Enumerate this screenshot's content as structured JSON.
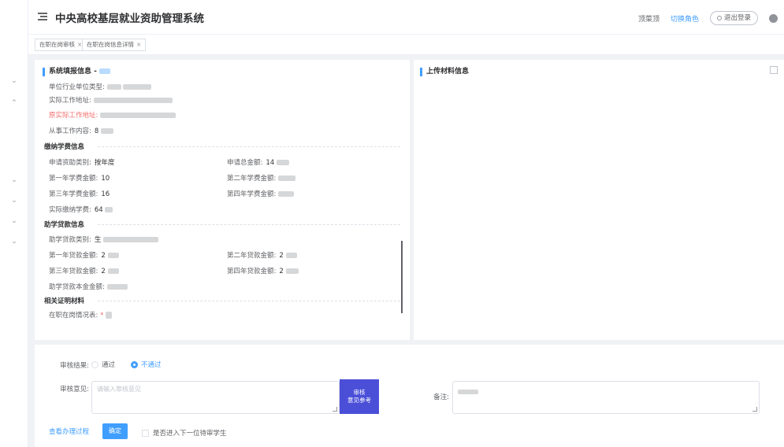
{
  "header": {
    "title": "中央高校基层就业资助管理系统",
    "links": [
      "顶菜顶",
      "切换角色"
    ],
    "logout": "退出登录"
  },
  "tabs": [
    {
      "label": "在职在岗审核"
    },
    {
      "label": "在职在岗信息详情"
    }
  ],
  "left_panel": {
    "title": "系统填报信息 - ",
    "rows": {
      "unit_type": "单位行业单位类型:",
      "work_address": "实际工作地址:",
      "original_address": "原实际工作地址:",
      "work_content": "从事工作内容:",
      "work_content_value": "8"
    },
    "tuition": {
      "title": "缴纳学费信息",
      "apply_type": "申请资助类别:",
      "apply_type_value": "按年度",
      "apply_total": "申请总金额:",
      "apply_total_value": "14",
      "y1": "第一年学费金额:",
      "y1_value": "10",
      "y2": "第二年学费金额:",
      "y3": "第三年学费金额:",
      "y3_value": "16",
      "y4": "第四年学费金额:",
      "actual": "实际缴纳学费:",
      "actual_value": "64"
    },
    "loan": {
      "title": "助学贷款信息",
      "loan_type": "助学贷款类别:",
      "loan_type_value": "生",
      "y1": "第一年贷款金额:",
      "y1_value": "2",
      "y2": "第二年贷款金额:",
      "y2_value": "2",
      "y3": "第三年贷款金额:",
      "y3_value": "2",
      "y4": "第四年贷款金额:",
      "y4_value": "2",
      "total": "助学贷款本金金额:"
    },
    "proof": {
      "title": "相关证明材料",
      "status": "在职在岗情况表:"
    }
  },
  "right_panel": {
    "title": "上传材料信息"
  },
  "review": {
    "result_label": "审核结果:",
    "pass": "通过",
    "fail": "不通过",
    "opinion_label": "审核意见:",
    "opinion_placeholder": "请输入审核意见",
    "ref_line1": "审核",
    "ref_line2": "意见参考",
    "remark_label": "备注:",
    "view_process": "查看办理过程",
    "confirm": "确定",
    "next_student": "是否进入下一位待审学生"
  },
  "colors": {
    "primary": "#409eff",
    "danger": "#f56c6c",
    "ref_button": "#4b4fd8"
  }
}
